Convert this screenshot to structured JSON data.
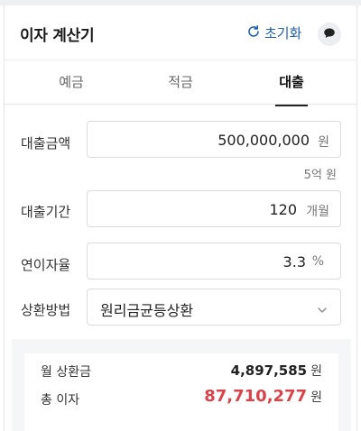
{
  "header": {
    "title": "이자 계산기",
    "reset_label": "초기화"
  },
  "tabs": [
    {
      "label": "예금",
      "active": false
    },
    {
      "label": "적금",
      "active": false
    },
    {
      "label": "대출",
      "active": true
    }
  ],
  "form": {
    "amount": {
      "label": "대출금액",
      "value": "500,000,000",
      "unit": "원",
      "hint": "5억 원"
    },
    "period": {
      "label": "대출기간",
      "value": "120",
      "unit": "개월"
    },
    "rate": {
      "label": "연이자율",
      "value": "3.3",
      "unit": "%"
    },
    "method": {
      "label": "상환방법",
      "selected": "원리금균등상환"
    }
  },
  "result": {
    "monthly_label": "월 상환금",
    "monthly_value": "4,897,585",
    "monthly_unit": "원",
    "total_label": "총 이자",
    "total_value": "87,710,277",
    "total_unit": "원"
  },
  "colors": {
    "accent_blue": "#1f5fae",
    "total_red": "#d9434b"
  },
  "icons": {
    "reset": "refresh-icon",
    "chat": "speech-bubble-icon",
    "dropdown": "chevron-down-icon"
  }
}
